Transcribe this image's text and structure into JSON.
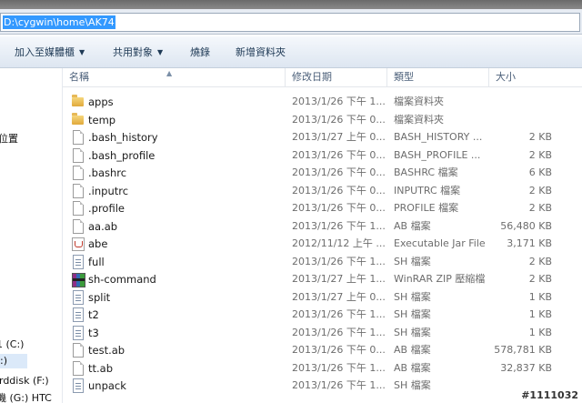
{
  "address_bar": {
    "path": "D:\\cygwin\\home\\AK74"
  },
  "toolbar": {
    "include_in_library": "加入至媒體櫃",
    "share_with": "共用對象",
    "burn": "燒錄",
    "new_folder": "新增資料夾"
  },
  "nav": {
    "items": [
      "位置",
      "1 (C:)",
      ":)",
      "rddisk (F:)",
      "機 (G:) HTC"
    ]
  },
  "columns": {
    "name": "名稱",
    "date": "修改日期",
    "type": "類型",
    "size": "大小"
  },
  "files": [
    {
      "name": "apps",
      "date": "2013/1/26 下午 1...",
      "type": "檔案資料夾",
      "size": "",
      "icon": "folder-icon"
    },
    {
      "name": "temp",
      "date": "2013/1/26 下午 0...",
      "type": "檔案資料夾",
      "size": "",
      "icon": "folder-icon"
    },
    {
      "name": ".bash_history",
      "date": "2013/1/27 上午 0...",
      "type": "BASH_HISTORY ...",
      "size": "2 KB",
      "icon": "document-icon"
    },
    {
      "name": ".bash_profile",
      "date": "2013/1/26 下午 0...",
      "type": "BASH_PROFILE ...",
      "size": "2 KB",
      "icon": "document-icon"
    },
    {
      "name": ".bashrc",
      "date": "2013/1/26 下午 0...",
      "type": "BASHRC 檔案",
      "size": "6 KB",
      "icon": "document-icon"
    },
    {
      "name": ".inputrc",
      "date": "2013/1/26 下午 0...",
      "type": "INPUTRC 檔案",
      "size": "2 KB",
      "icon": "document-icon"
    },
    {
      "name": ".profile",
      "date": "2013/1/26 下午 0...",
      "type": "PROFILE 檔案",
      "size": "2 KB",
      "icon": "document-icon"
    },
    {
      "name": "aa.ab",
      "date": "2013/1/26 下午 1...",
      "type": "AB 檔案",
      "size": "56,480 KB",
      "icon": "document-icon"
    },
    {
      "name": "abe",
      "date": "2012/11/12 上午 ...",
      "type": "Executable Jar File",
      "size": "3,171 KB",
      "icon": "jar-icon"
    },
    {
      "name": "full",
      "date": "2013/1/26 下午 1...",
      "type": "SH 檔案",
      "size": "2 KB",
      "icon": "text-file-icon"
    },
    {
      "name": "sh-command",
      "date": "2013/1/27 上午 1...",
      "type": "WinRAR ZIP 壓縮檔",
      "size": "2 KB",
      "icon": "winrar-icon"
    },
    {
      "name": "split",
      "date": "2013/1/27 上午 0...",
      "type": "SH 檔案",
      "size": "1 KB",
      "icon": "text-file-icon"
    },
    {
      "name": "t2",
      "date": "2013/1/26 下午 1...",
      "type": "SH 檔案",
      "size": "1 KB",
      "icon": "text-file-icon"
    },
    {
      "name": "t3",
      "date": "2013/1/26 下午 1...",
      "type": "SH 檔案",
      "size": "1 KB",
      "icon": "text-file-icon"
    },
    {
      "name": "test.ab",
      "date": "2013/1/26 下午 0...",
      "type": "AB 檔案",
      "size": "578,781 KB",
      "icon": "document-icon"
    },
    {
      "name": "tt.ab",
      "date": "2013/1/26 下午 1...",
      "type": "AB 檔案",
      "size": "32,837 KB",
      "icon": "document-icon"
    },
    {
      "name": "unpack",
      "date": "2013/1/26 下午 1...",
      "type": "SH 檔案",
      "size": "",
      "icon": "text-file-icon"
    }
  ],
  "watermark": "#1111032",
  "colors": {
    "selection": "#3399ff",
    "toolbar_text": "#1e3955",
    "header_text": "#4c607a"
  }
}
